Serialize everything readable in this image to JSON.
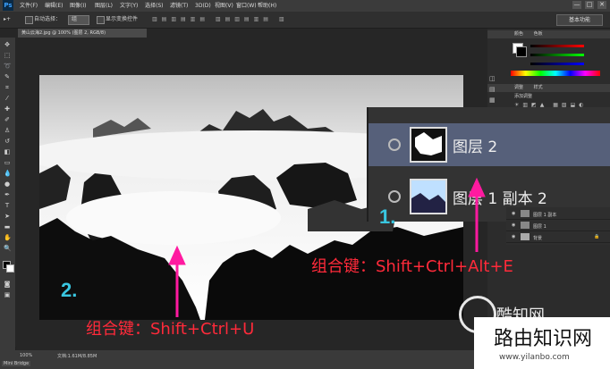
{
  "menubar": {
    "app_icon": "Ps",
    "items": [
      "文件(F)",
      "编辑(E)",
      "图像(I)",
      "图层(L)",
      "文字(Y)",
      "选择(S)",
      "滤镜(T)",
      "3D(D)",
      "视图(V)",
      "窗口(W)",
      "帮助(H)"
    ],
    "window_controls": [
      "—",
      "□",
      "✕"
    ]
  },
  "options_bar": {
    "auto_select_label": "自动选择：",
    "auto_select_value": "组",
    "show_transform_label": "显示变换控件",
    "workspace": "基本功能"
  },
  "document_tab": "黄山云海2.jpg @ 100% (图层 2, RGB/8)",
  "layers_zoom": {
    "rows": [
      {
        "name": "图层 2",
        "selected": true
      },
      {
        "name": "图层 1 副本 2",
        "selected": false
      }
    ]
  },
  "layers_small": {
    "rows": [
      "图层 1 副本",
      "图层 1",
      "背景"
    ]
  },
  "right_panels": {
    "color_tab": "颜色",
    "color_tab2": "色板",
    "adjust_tab": "调整",
    "adjust_tab2": "样式",
    "adjust_hint": "添加调整"
  },
  "status": {
    "zoom": "100%",
    "doc": "文档:1.61M/8.85M",
    "minibridge": "Mini Bridge"
  },
  "annotations": {
    "step1_num": "1.",
    "step1_text": "组合键：Shift+Ctrl+Alt+E",
    "step2_num": "2.",
    "step2_text": "组合键：Shift+Ctrl+U",
    "arrow_color": "#ff1aa0",
    "num_color": "#39c6e0",
    "text_color": "#ff2a3a"
  },
  "watermarks": {
    "site1": "酷知网",
    "site2_name": "路由知识网",
    "site2_url": "www.yilanbo.com"
  }
}
